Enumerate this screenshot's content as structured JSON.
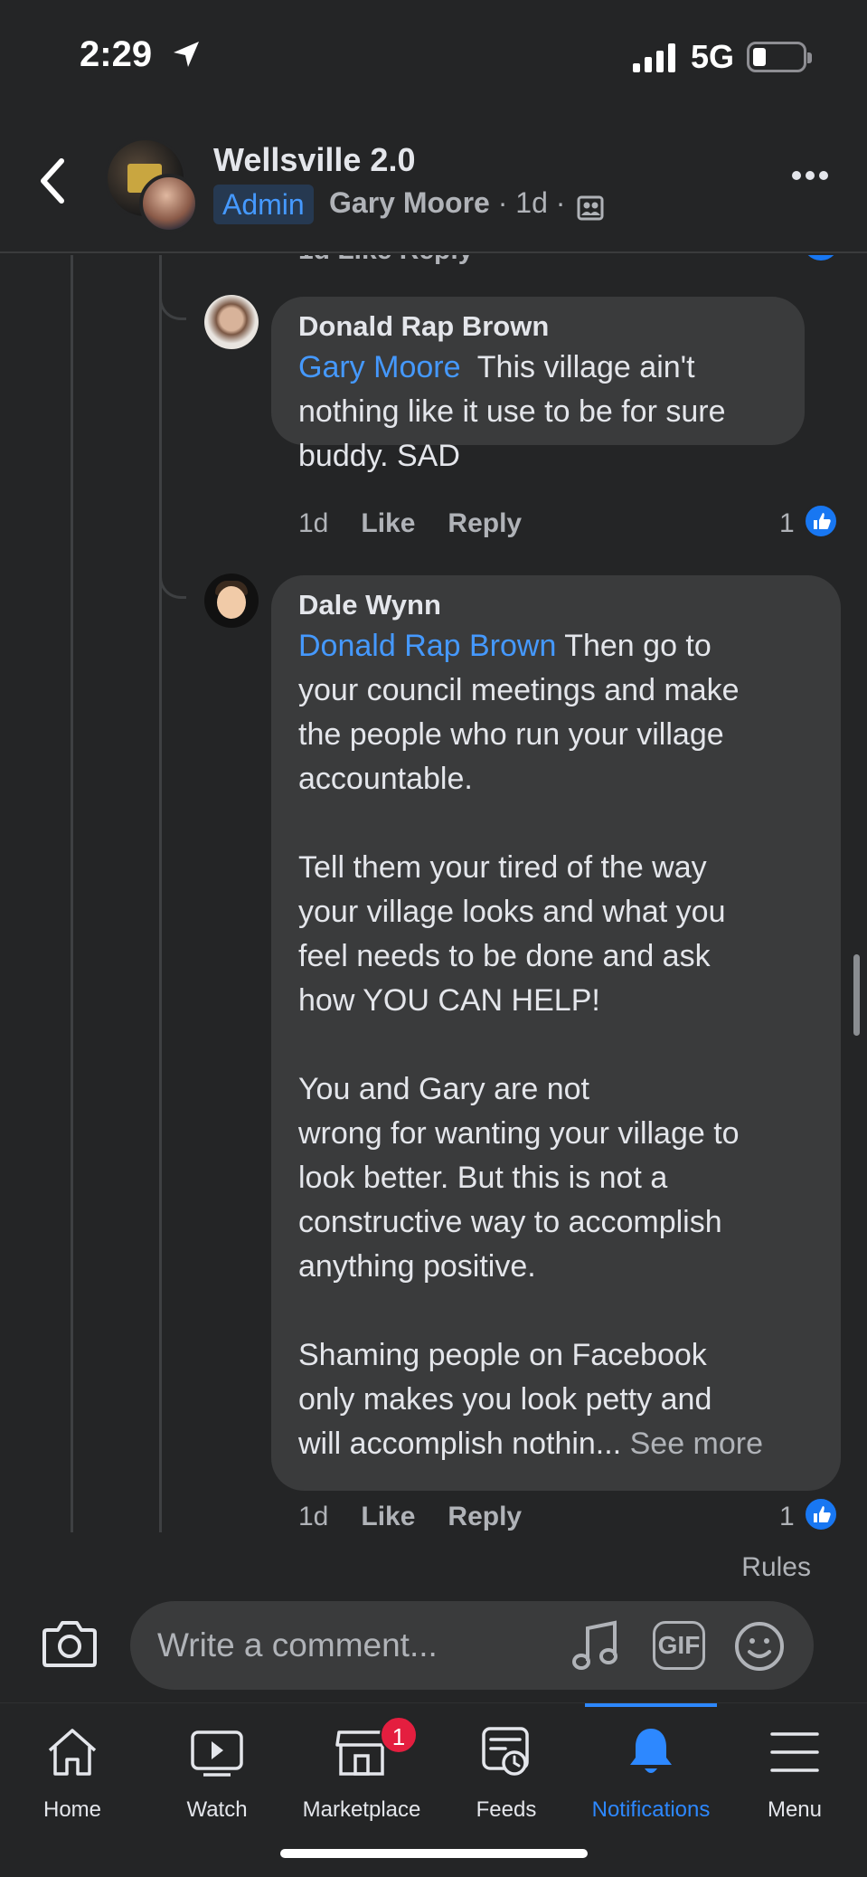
{
  "status_bar": {
    "time": "2:29",
    "network": "5G"
  },
  "header": {
    "group_name": "Wellsville 2.0",
    "admin_badge": "Admin",
    "author": "Gary Moore",
    "meta_suffix": " · 1d ·"
  },
  "previous_comment": {
    "actions": "1d   Like   Reply",
    "like_count": "1"
  },
  "comments": [
    {
      "name": "Donald Rap Brown",
      "mention": "Gary Moore",
      "text": "  This village ain't\nnothing like it use to be for sure\nbuddy. SAD",
      "time": "1d",
      "like_label": "Like",
      "reply_label": "Reply",
      "like_count": "1"
    },
    {
      "name": "Dale Wynn",
      "mention": "Donald Rap Brown",
      "text": " Then go to\nyour council meetings and make\nthe people who run your village\naccountable.\n\nTell them your tired of the way\nyour village looks and what you\nfeel needs to be done and ask\nhow YOU CAN HELP!\n\nYou and Gary are not\nwrong for wanting your village to\nlook better. But this is not a\nconstructive way to accomplish\nanything positive.\n\nShaming people on Facebook\nonly makes you look petty and\nwill accomplish nothin... ",
      "see_more": "See more",
      "time": "1d",
      "like_label": "Like",
      "reply_label": "Reply",
      "like_count": "1"
    }
  ],
  "composer": {
    "rules": "Rules",
    "placeholder": "Write a comment...",
    "gif": "GIF"
  },
  "nav": {
    "items": [
      {
        "label": "Home",
        "icon": "home-icon"
      },
      {
        "label": "Watch",
        "icon": "watch-icon"
      },
      {
        "label": "Marketplace",
        "icon": "marketplace-icon",
        "badge": "1"
      },
      {
        "label": "Feeds",
        "icon": "feeds-icon"
      },
      {
        "label": "Notifications",
        "icon": "bell-icon"
      },
      {
        "label": "Menu",
        "icon": "menu-icon"
      }
    ],
    "active": "Notifications"
  },
  "colors": {
    "background": "#242526",
    "bubble": "#3a3b3c",
    "accent": "#2d88ff",
    "mention": "#4599ff",
    "badge": "#e41e3f"
  }
}
